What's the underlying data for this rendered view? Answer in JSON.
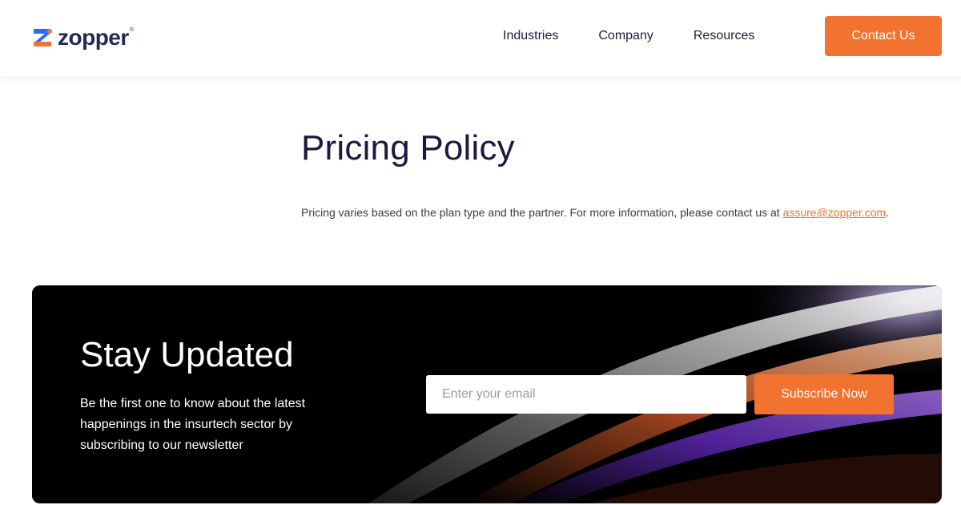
{
  "brand": {
    "name": "zopper",
    "registered_mark": "®",
    "logo_icon": "zopper-z-logo-icon",
    "colors": {
      "accent": "#f27330",
      "navy": "#1f2a55",
      "blue": "#2e6bf0"
    }
  },
  "nav": {
    "items": [
      {
        "label": "Industries"
      },
      {
        "label": "Company"
      },
      {
        "label": "Resources"
      }
    ],
    "cta_label": "Contact Us"
  },
  "main": {
    "title": "Pricing Policy",
    "text_before": "Pricing varies based on the plan type and the partner. For more information, please contact us at ",
    "email_link": "assure@zopper.com",
    "text_after": "."
  },
  "newsletter": {
    "title": "Stay Updated",
    "description": "Be the first one to know about the latest happenings in the insurtech sector by subscribing to our newsletter",
    "email_placeholder": "Enter your email",
    "email_value": "",
    "subscribe_label": "Subscribe Now"
  }
}
